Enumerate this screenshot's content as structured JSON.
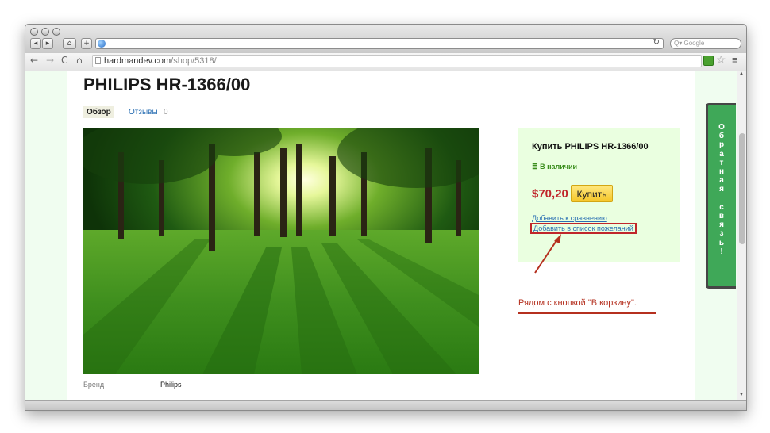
{
  "browser": {
    "search_placeholder": "Google",
    "url_host": "hardmandev.com",
    "url_path": "/shop/5318/",
    "title_reload": "↻"
  },
  "product": {
    "title": "PHILIPS HR-1366/00",
    "tabs": [
      {
        "label": "Обзор",
        "active": true
      },
      {
        "label": "Отзывы",
        "count": "0",
        "active": false
      }
    ],
    "attributes": [
      {
        "key": "Бренд",
        "value": "Philips"
      }
    ]
  },
  "buy_box": {
    "title": "Купить PHILIPS HR-1366/00",
    "stock_icon": "list-icon",
    "stock": "В наличии",
    "price": "$70,20",
    "buy_label": "Купить",
    "compare_link": "Добавить к сравнению",
    "wishlist_link": "Добавить в список пожеланий"
  },
  "annotation": {
    "text": "Рядом с кнопкой \"В корзину\".",
    "color": "#b5301f"
  },
  "feedback_tab": {
    "text": "Обратная связь!",
    "background": "#3fa858"
  },
  "colors": {
    "page_background": "#f0fdf0",
    "buy_box_background": "#eaffe0",
    "price": "#c0262b",
    "link": "#2a6fb3",
    "buy_button": "#f5c629"
  }
}
